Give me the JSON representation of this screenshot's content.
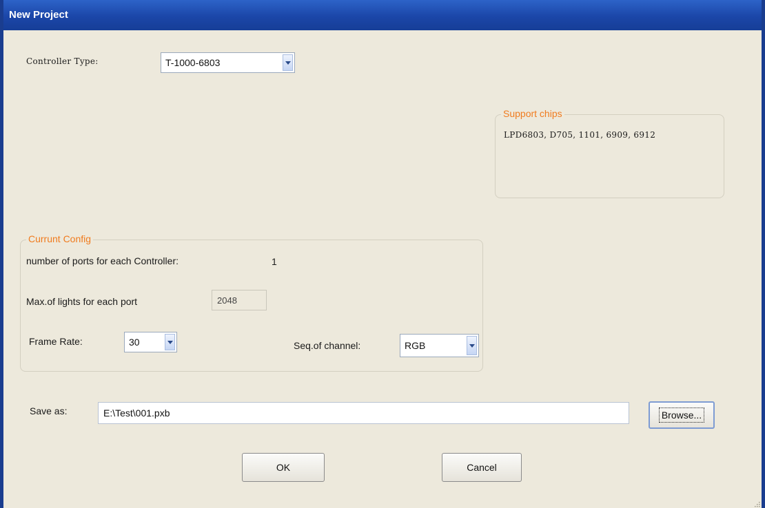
{
  "window": {
    "title": "New Project"
  },
  "controller": {
    "label": "Controller Type:",
    "value": "T-1000-6803"
  },
  "support_chips": {
    "title": "Support chips",
    "text": "LPD6803, D705, 1101, 6909, 6912"
  },
  "current_config": {
    "title": "Currunt Config",
    "ports_label": "number of ports for each Controller:",
    "ports_value": "1",
    "max_lights_label": "Max.of lights for each port",
    "max_lights_value": "2048",
    "frame_rate_label": "Frame Rate:",
    "frame_rate_value": "30",
    "seq_label": "Seq.of channel:",
    "seq_value": "RGB"
  },
  "save": {
    "label": "Save as:",
    "path": "E:\\Test\\001.pxb",
    "browse_label": "Browse..."
  },
  "buttons": {
    "ok_label": "OK",
    "cancel_label": "Cancel"
  },
  "icons": {
    "dropdown": "chevron-down-icon",
    "resize": "resize-grip-icon"
  },
  "colors": {
    "titlebar": "#1b46a8",
    "group_title": "#f07b1e",
    "background": "#ede9dc"
  }
}
